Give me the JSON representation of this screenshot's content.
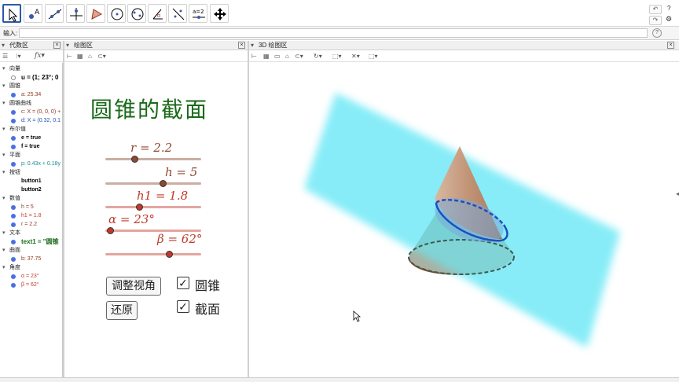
{
  "toolbar": {
    "tools": [
      {
        "name": "move-tool-icon",
        "selected": true
      },
      {
        "name": "point-tool-icon",
        "label": "A"
      },
      {
        "name": "line-tool-icon"
      },
      {
        "name": "perpendicular-line-tool-icon"
      },
      {
        "name": "polygon-tool-icon"
      },
      {
        "name": "circle-tool-icon"
      },
      {
        "name": "conic-tool-icon"
      },
      {
        "name": "angle-tool-icon"
      },
      {
        "name": "reflect-tool-icon"
      },
      {
        "name": "slider-tool-icon",
        "label": "a=2"
      },
      {
        "name": "move-view-tool-icon"
      }
    ]
  },
  "input_bar": {
    "label": "输入:",
    "value": ""
  },
  "panels": {
    "algebra": "代数区",
    "graphics": "绘图区",
    "graphics3d": "3D 绘图区"
  },
  "algebra": {
    "rows": [
      {
        "type": "head",
        "text": "向量"
      },
      {
        "type": "item",
        "text": "u = (1; 23°; 0",
        "color": "#000000",
        "dot": "#ffffff",
        "bold": true,
        "big": true
      },
      {
        "type": "head",
        "text": "圆锥"
      },
      {
        "type": "item",
        "text": "a: 25.34",
        "color": "#8b3a1a",
        "dot": "#4a6fe3"
      },
      {
        "type": "head",
        "text": "圆锥曲线"
      },
      {
        "type": "item",
        "text": "c: X = (0, 0, 0) +",
        "color": "#8b3a1a",
        "dot": "#4a6fe3"
      },
      {
        "type": "item",
        "text": "d: X = (0.32, 0.1",
        "color": "#2050b0",
        "dot": "#4a6fe3"
      },
      {
        "type": "head",
        "text": "布尔值"
      },
      {
        "type": "item",
        "text": "e = true",
        "color": "#000000",
        "dot": "#4a6fe3",
        "bold": true
      },
      {
        "type": "item",
        "text": "f = true",
        "color": "#000000",
        "dot": "#4a6fe3",
        "bold": true
      },
      {
        "type": "head",
        "text": "平面"
      },
      {
        "type": "item",
        "text": "p: 0.43x + 0.18y",
        "color": "#1a8a9a",
        "dot": "#4a6fe3"
      },
      {
        "type": "head",
        "text": "按钮"
      },
      {
        "type": "item",
        "text": "button1",
        "color": "#000000",
        "dot": "none",
        "bold": true
      },
      {
        "type": "item",
        "text": "button2",
        "color": "#000000",
        "dot": "none",
        "bold": true
      },
      {
        "type": "head",
        "text": "数值"
      },
      {
        "type": "item",
        "text": "h = 5",
        "color": "#8b3a1a",
        "dot": "#4a6fe3"
      },
      {
        "type": "item",
        "text": "h1 = 1.8",
        "color": "#c0392b",
        "dot": "#4a6fe3"
      },
      {
        "type": "item",
        "text": "r = 2.2",
        "color": "#8b3a1a",
        "dot": "#4a6fe3"
      },
      {
        "type": "head",
        "text": "文本"
      },
      {
        "type": "item",
        "text": "text1 = \"圆锥",
        "color": "#1a6a1a",
        "dot": "#4a6fe3",
        "bold": true,
        "big": true
      },
      {
        "type": "head",
        "text": "曲面"
      },
      {
        "type": "item",
        "text": "b: 37.75",
        "color": "#8b3a1a",
        "dot": "#4a6fe3"
      },
      {
        "type": "head",
        "text": "角度"
      },
      {
        "type": "item",
        "text": "α = 23°",
        "color": "#c0392b",
        "dot": "#4a6fe3"
      },
      {
        "type": "item",
        "text": "β = 62°",
        "color": "#c0392b",
        "dot": "#4a6fe3"
      }
    ]
  },
  "graphics": {
    "title": "圆锥的截面",
    "title_color": "#1a6a1a",
    "sliders": [
      {
        "label": "r = 2.2",
        "fraction": 0.3,
        "color": "#8b4a30"
      },
      {
        "label": "h = 5",
        "fraction": 0.6,
        "color": "#8b4a30"
      },
      {
        "label": "h1 = 1.8",
        "fraction": 0.35,
        "color": "#c0392b"
      },
      {
        "label": "α = 23°",
        "fraction": 0.05,
        "color": "#c0392b"
      },
      {
        "label": "β = 62°",
        "fraction": 0.66,
        "color": "#c0392b"
      }
    ],
    "buttons": {
      "adjust": "调整视角",
      "reset": "还原"
    },
    "checkboxes": [
      {
        "label": "圆锥",
        "checked": true
      },
      {
        "label": "截面",
        "checked": true
      }
    ]
  },
  "colors": {
    "plane": "#5ee6f5",
    "cone": "#c08a6a",
    "section": "#3a68c8"
  }
}
